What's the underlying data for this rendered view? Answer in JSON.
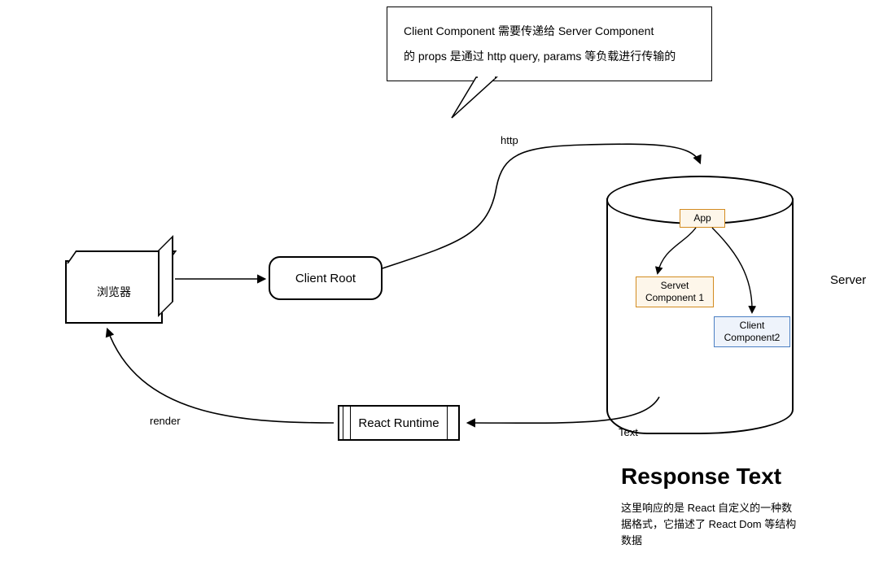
{
  "bubble": {
    "line1": "Client Component 需要传递给 Server Component",
    "line2": "的 props 是通过 http query, params 等负载进行传输的"
  },
  "nodes": {
    "browser": "浏览器",
    "client_root": "Client Root",
    "react_runtime": "React Runtime",
    "server_label": "Server",
    "app": "App",
    "servet_component1": "Servet Component 1",
    "client_component2": "Client Component2"
  },
  "edges": {
    "http": "http",
    "text": "Text",
    "render": "render"
  },
  "response": {
    "title": "Response Text",
    "body": "这里响应的是 React 自定义的一种数据格式，它描述了 React Dom 等结构数据"
  }
}
